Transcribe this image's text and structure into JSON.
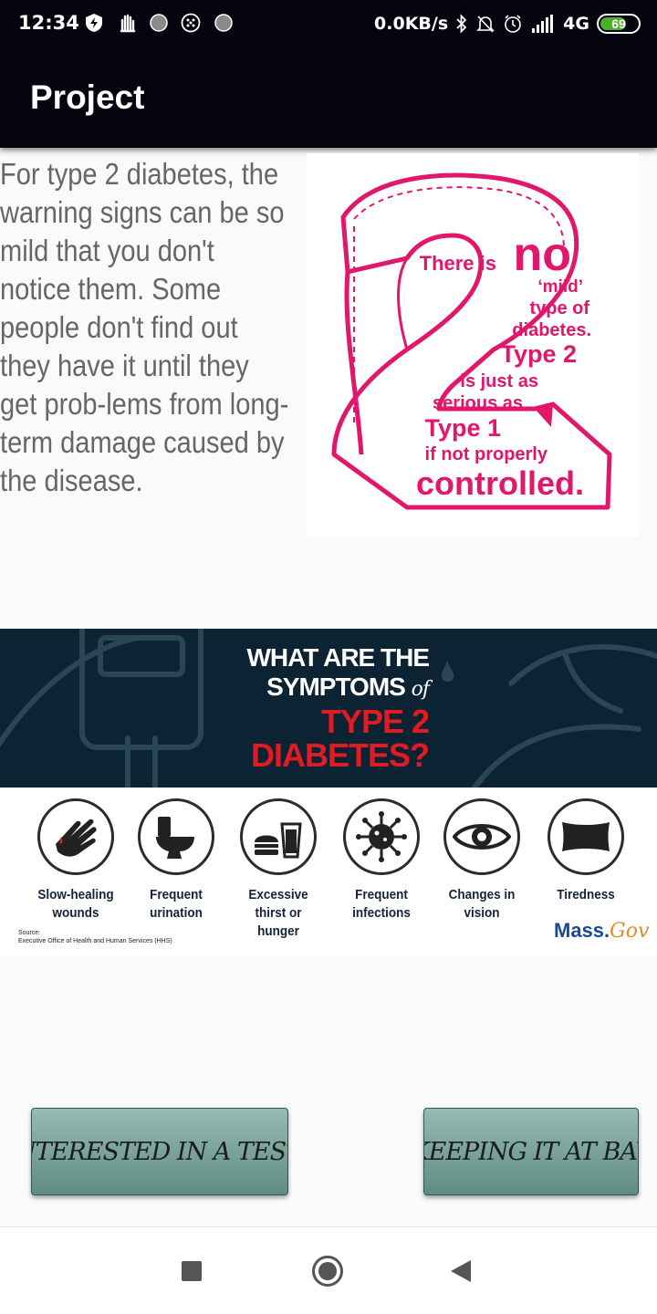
{
  "status_bar": {
    "time": "12:34",
    "net_speed": "0.0KB/s",
    "network": "4G",
    "battery_level": "69",
    "battery_fraction": 0.69,
    "icons": [
      "shield-bolt-icon",
      "hand-icon",
      "circle-icon",
      "grid-circle-icon",
      "circle-icon",
      "bluetooth-icon",
      "mute-bell-icon",
      "alarm-icon",
      "signal-icon",
      "battery-icon"
    ]
  },
  "app_bar": {
    "title": "Project"
  },
  "content": {
    "intro_text": " For type 2 diabetes, the warning signs can be so mild that you don't notice them. Some people don't find out they have it until they get prob-lems from long-term damage caused by the disease.",
    "two_graphic": {
      "line1": "There is",
      "line1_big": "no",
      "line2": "‘mild’",
      "line3": "type of",
      "line4": "diabetes.",
      "line5": "Type 2",
      "line6": "is just as",
      "line7": "serious as",
      "line8": "Type 1",
      "line9": "if not properly",
      "line10": "controlled.",
      "color": "#e0176b"
    },
    "symptoms_banner": {
      "title_line1": "WHAT ARE THE",
      "title_line2": "SYMPTOMS",
      "title_of": "of",
      "title_line3": "TYPE 2",
      "title_line4": "DIABETES?",
      "symptoms": [
        {
          "label": "Slow-healing wounds",
          "icon": "hand-wound-icon"
        },
        {
          "label": "Frequent urination",
          "icon": "toilet-icon"
        },
        {
          "label": "Excessive thirst or hunger",
          "icon": "burger-drink-icon"
        },
        {
          "label": "Frequent infections",
          "icon": "virus-icon"
        },
        {
          "label": "Changes in vision",
          "icon": "eye-icon"
        },
        {
          "label": "Tiredness",
          "icon": "pillow-icon"
        }
      ],
      "source_label": "Source:",
      "source_text": "Executive Office of Health and Human Services (HHS)",
      "brand_mass": "Mass.",
      "brand_gov": "Gov"
    }
  },
  "buttons": {
    "test_label": "INTERESTED IN A TEST?",
    "bay_label": "KEEPING IT AT BAY"
  },
  "colors": {
    "app_bar": "#05050f",
    "banner_dark": "#0c2333",
    "banner_red": "#e11b22",
    "button": "#7aa59c"
  }
}
